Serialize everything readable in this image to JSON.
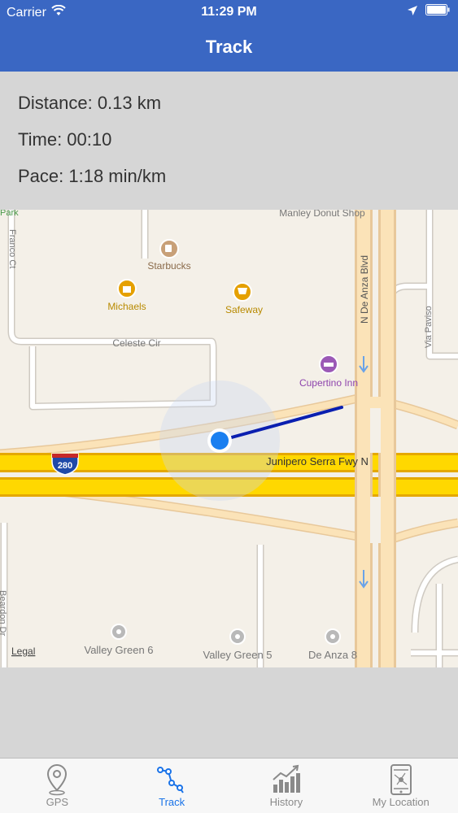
{
  "status_bar": {
    "carrier": "Carrier",
    "time": "11:29 PM"
  },
  "nav": {
    "title": "Track"
  },
  "stats": [
    {
      "label": "Distance: 0.13 km"
    },
    {
      "label": "Time: 00:10"
    },
    {
      "label": "Pace: 1:18 min/km"
    }
  ],
  "map": {
    "labels": {
      "park": "Park",
      "donut": "Manley Donut Shop",
      "franco": "Franco Ct",
      "starbucks": "Starbucks",
      "michaels": "Michaels",
      "safeway": "Safeway",
      "celeste": "Celeste Cir",
      "deanza_blvd": "N De Anza Blvd",
      "via_paviso": "Via Paviso",
      "cupertino_inn": "Cupertino Inn",
      "shield_280": "280",
      "junipero": "Junipero Serra Fwy N",
      "beardon": "Beardon Dr",
      "legal": "Legal",
      "valley6": "Valley Green 6",
      "valley5": "Valley Green 5",
      "deanza8": "De Anza 8"
    },
    "colors": {
      "track": "#0a1fb0",
      "location_dot": "#1a7ff0",
      "freeway": "#ffd800",
      "poi_orange": "#e5a000",
      "poi_purple": "#9b59b6"
    }
  },
  "tabs": [
    {
      "label": "GPS",
      "icon": "map-pin-icon",
      "active": false
    },
    {
      "label": "Track",
      "icon": "route-icon",
      "active": true
    },
    {
      "label": "History",
      "icon": "bar-chart-icon",
      "active": false
    },
    {
      "label": "My Location",
      "icon": "phone-map-icon",
      "active": false
    }
  ]
}
